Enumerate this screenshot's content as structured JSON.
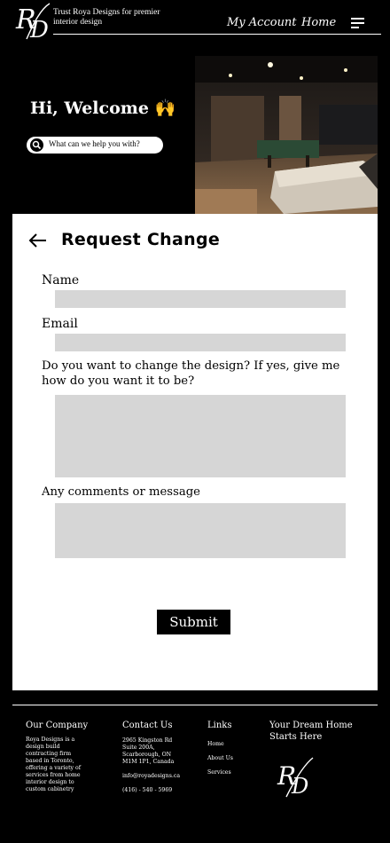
{
  "header": {
    "brand_lettering": "RD",
    "tagline": "Trust Roya Designs for premier interior design",
    "nav": {
      "account_label": "My Account",
      "home_label": "Home"
    }
  },
  "hero": {
    "welcome": "Hi, Welcome 🙌",
    "search_placeholder": "What can we help you with?"
  },
  "form": {
    "title": "Request Change",
    "name_label": "Name",
    "email_label": "Email",
    "design_label_line1": "Do you want to change the design? If yes, give me",
    "design_label_line2": "how do you want it to be?",
    "comments_label": "Any comments or message",
    "submit_label": "Submit"
  },
  "footer": {
    "company": {
      "heading": "Our Company",
      "lines": [
        "Roya Designs is a",
        "design build",
        "contracting firm",
        "based in Toronto,",
        "offering a variety of",
        "services from home",
        "interior design to",
        "custom cabinetry"
      ]
    },
    "contact": {
      "heading": "Contact Us",
      "address": [
        "2965 Kingston Rd",
        "Suite 200A,",
        "Scarborough, ON",
        "M1M 1P1, Canada"
      ],
      "email": "info@royadesigns.ca",
      "phone": "(416) - 540 - 5969"
    },
    "links": {
      "heading": "Links",
      "items": [
        "Home",
        "About Us",
        "Services"
      ]
    },
    "dream": {
      "line1": "Your Dream Home",
      "line2": "Starts Here"
    }
  },
  "colors": {
    "background": "#000000",
    "card": "#ffffff",
    "input": "#d6d6d6",
    "button": "#000000"
  }
}
